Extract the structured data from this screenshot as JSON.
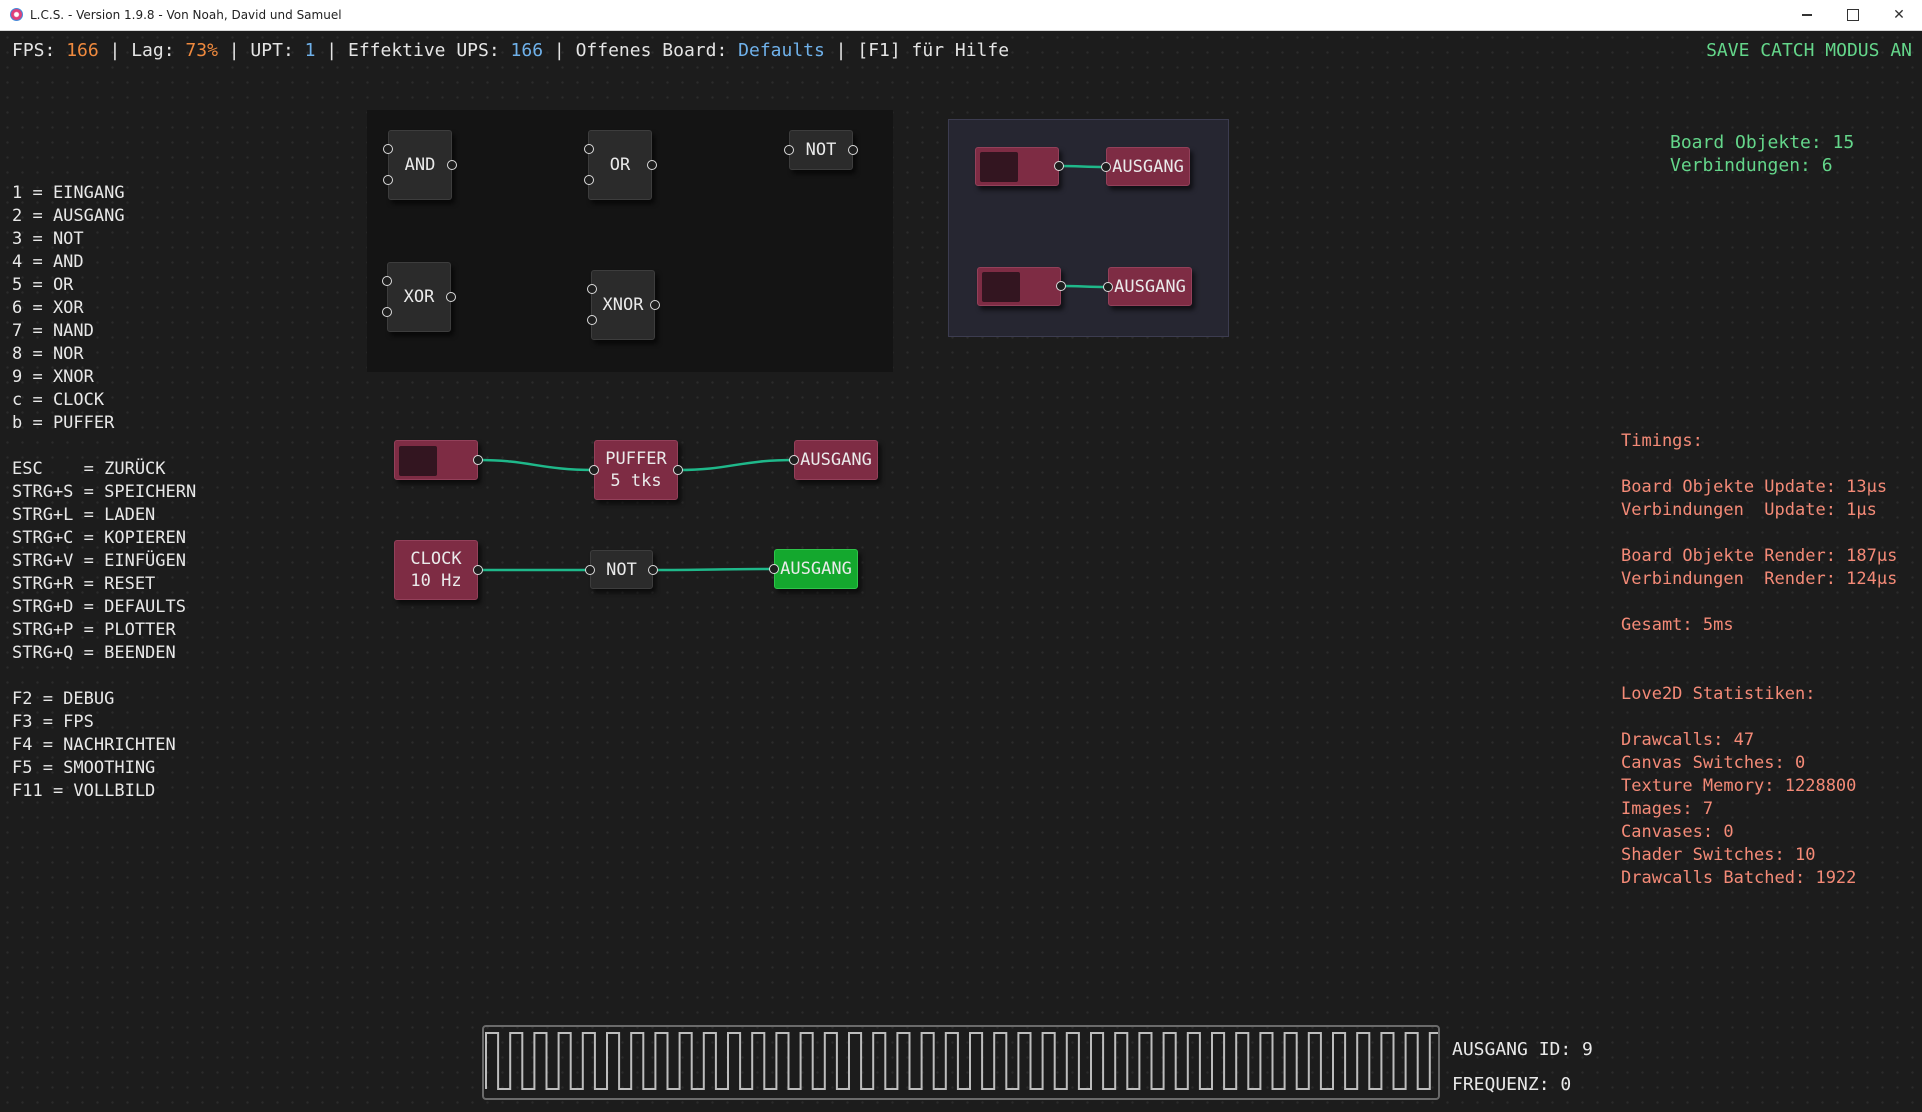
{
  "window": {
    "title": "L.C.S. - Version 1.9.8 - Von Noah, David und Samuel",
    "minimize_icon": "minimize-icon",
    "maximize_icon": "maximize-icon",
    "close_icon": "close-icon"
  },
  "status": {
    "fps_label": "FPS: ",
    "fps_value": "166",
    "lag_label": " | Lag: ",
    "lag_value": "73%",
    "upt_label": " | UPT: ",
    "upt_value": "1",
    "ups_label": " | Effektive UPS: ",
    "ups_value": "166",
    "board_label": " | Offenes Board: ",
    "board_value": "Defaults",
    "help": " | [F1] für Hilfe",
    "save_catch": "SAVE CATCH MODUS AN"
  },
  "keyhelp": {
    "lines": [
      "1 = EINGANG",
      "2 = AUSGANG",
      "3 = NOT",
      "4 = AND",
      "5 = OR",
      "6 = XOR",
      "7 = NAND",
      "8 = NOR",
      "9 = XNOR",
      "c = CLOCK",
      "b = PUFFER",
      "",
      "ESC    = ZURÜCK",
      "STRG+S = SPEICHERN",
      "STRG+L = LADEN",
      "STRG+C = KOPIEREN",
      "STRG+V = EINFÜGEN",
      "STRG+R = RESET",
      "STRG+D = DEFAULTS",
      "STRG+P = PLOTTER",
      "STRG+Q = BEENDEN",
      "",
      "F2 = DEBUG",
      "F3 = FPS",
      "F4 = NACHRICHTEN",
      "F5 = SMOOTHING",
      "F11 = VOLLBILD"
    ]
  },
  "board_stats": {
    "objects": "Board Objekte: 15",
    "connections": "Verbindungen: 6"
  },
  "timings": {
    "lines": [
      "Timings:",
      "",
      "Board Objekte Update: 13µs",
      "Verbindungen  Update: 1µs",
      "",
      "Board Objekte Render: 187µs",
      "Verbindungen  Render: 124µs",
      "",
      "Gesamt: 5ms",
      "",
      "",
      "Love2D Statistiken:",
      "",
      "Drawcalls: 47",
      "Canvas Switches: 0",
      "Texture Memory: 1228800",
      "Images: 7",
      "Canvases: 0",
      "Shader Switches: 10",
      "Drawcalls Batched: 1922"
    ]
  },
  "nodes": {
    "and": "AND",
    "or": "OR",
    "not_top": "NOT",
    "xor": "XOR",
    "xnor": "XNOR",
    "ausgang_1": "AUSGANG",
    "ausgang_2": "AUSGANG",
    "puffer_title": "PUFFER",
    "puffer_ticks": "5 tks",
    "ausgang_3": "AUSGANG",
    "clock_title": "CLOCK",
    "clock_freq": "10 Hz",
    "not_mid": "NOT",
    "ausgang_4": "AUSGANG"
  },
  "colors": {
    "background": "#1c1c1c",
    "wire": "#1fb88a",
    "io_node": "#7e2c44",
    "active_output": "#14a82e",
    "gate": "#2b2b2b",
    "status_orange": "#f08a3e",
    "status_blue": "#6fb1ea",
    "stats_green": "#64d68a",
    "timings_salmon": "#f48a77"
  },
  "plotter": {
    "id_label": "AUSGANG ID: 9",
    "freq_label": "FREQUENZ: 0"
  }
}
